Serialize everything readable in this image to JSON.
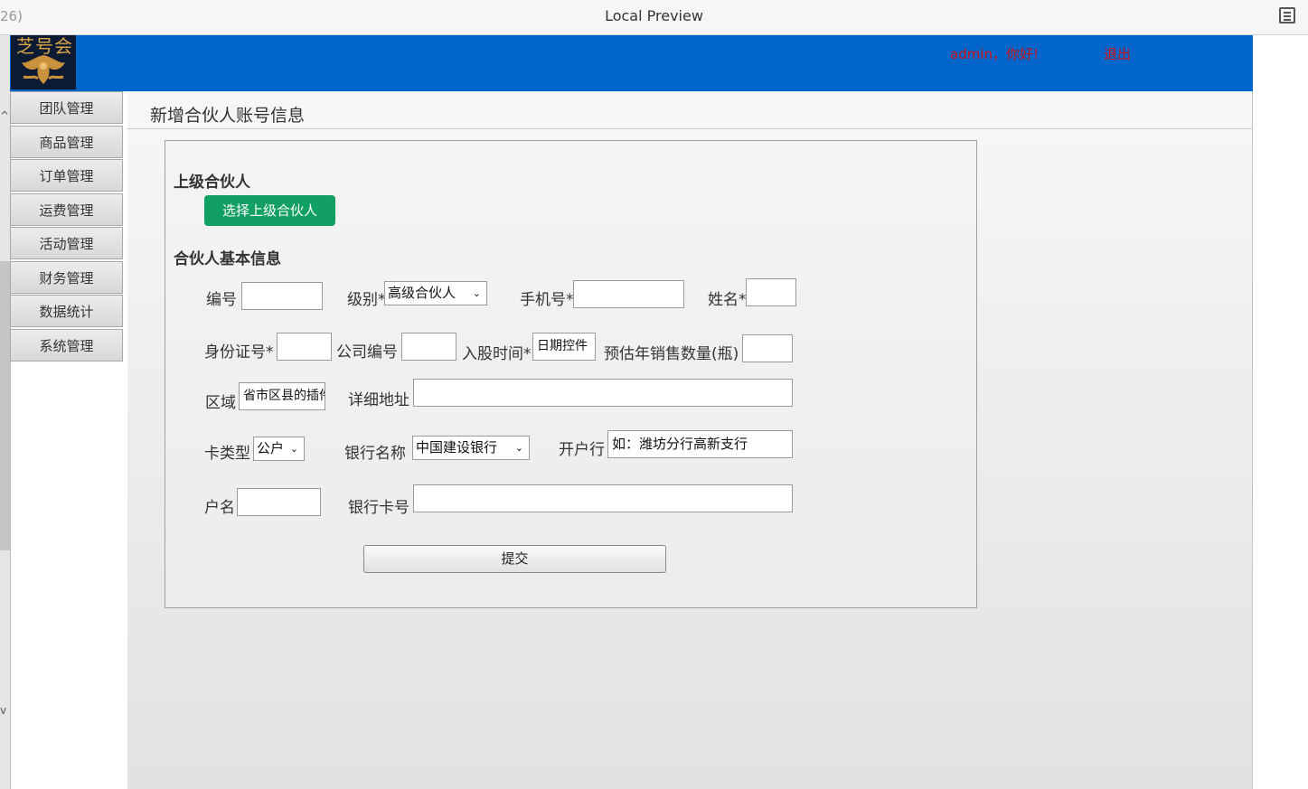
{
  "window": {
    "title": "Local Preview",
    "tab_fragment": "26)",
    "menu_icon": "list-icon"
  },
  "header": {
    "logo_text": "芝号会",
    "welcome": "admin，你好!",
    "logout": "退出",
    "bg_color": "#0066cc",
    "text_color": "#cc1111"
  },
  "sidebar": {
    "items": [
      {
        "label": "团队管理"
      },
      {
        "label": "商品管理"
      },
      {
        "label": "订单管理"
      },
      {
        "label": "运费管理"
      },
      {
        "label": "活动管理"
      },
      {
        "label": "财务管理"
      },
      {
        "label": "数据统计"
      },
      {
        "label": "系统管理"
      }
    ]
  },
  "page": {
    "title": "新增合伙人账号信息"
  },
  "form": {
    "superior_section": "上级合伙人",
    "select_superior_button": "选择上级合伙人",
    "basic_section": "合伙人基本信息",
    "fields": {
      "number_label": "编号",
      "level_label": "级别*",
      "level_value": "高级合伙人",
      "phone_label": "手机号*",
      "name_label": "姓名*",
      "id_label": "身份证号*",
      "company_label": "公司编号",
      "join_label": "入股时间*",
      "join_value": "日期控件",
      "sales_label": "预估年销售数量(瓶)",
      "region_label": "区域",
      "region_value": "省市区县的插件",
      "address_label": "详细地址",
      "card_type_label": "卡类型",
      "card_type_value": "公户",
      "bank_label": "银行名称",
      "bank_value": "中国建设银行",
      "branch_label": "开户行",
      "branch_placeholder": "如：潍坊分行高新支行",
      "holder_label": "户名",
      "card_no_label": "银行卡号"
    },
    "submit": "提交",
    "green_color": "#119f63"
  }
}
